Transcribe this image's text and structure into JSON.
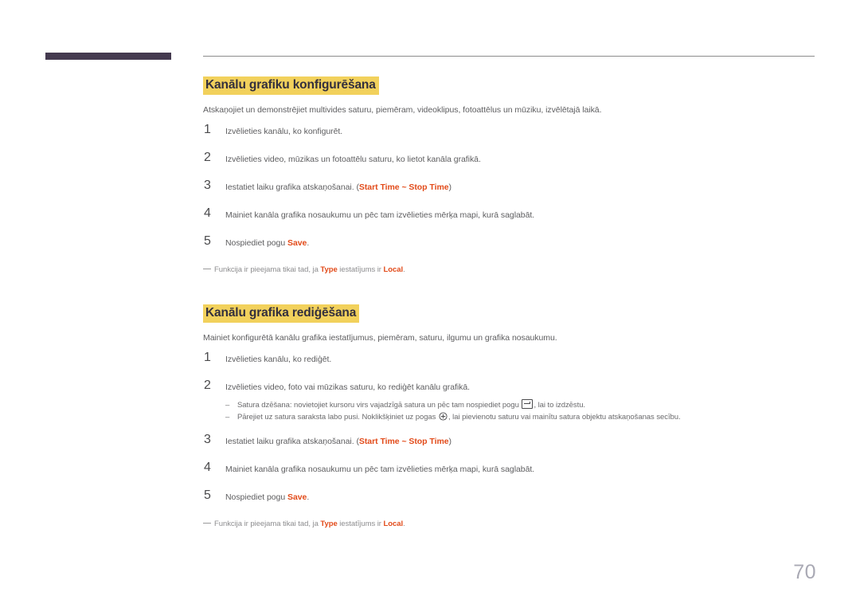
{
  "page": {
    "number": "70",
    "accent_color": "#e24b1a",
    "highlight_color": "#f2d15c",
    "header_bar_color": "#443a4f"
  },
  "sections": [
    {
      "heading": "Kanālu grafiku konfigurēšana",
      "intro": "Atskaņojiet un demonstrējiet multivides saturu, piemēram, videoklipus, fotoattēlus un mūziku, izvēlētajā laikā.",
      "steps": [
        {
          "num": "1",
          "parts": [
            {
              "t": "text",
              "v": "Izvēlieties kanālu, ko konfigurēt."
            }
          ]
        },
        {
          "num": "2",
          "parts": [
            {
              "t": "text",
              "v": "Izvēlieties video, mūzikas un fotoattēlu saturu, ko lietot kanāla grafikā."
            }
          ]
        },
        {
          "num": "3",
          "parts": [
            {
              "t": "text",
              "v": "Iestatiet laiku grafika atskaņošanai. ("
            },
            {
              "t": "kw",
              "v": "Start Time"
            },
            {
              "t": "kw",
              "v": " ~ "
            },
            {
              "t": "kw",
              "v": "Stop Time"
            },
            {
              "t": "text",
              "v": ")"
            }
          ]
        },
        {
          "num": "4",
          "parts": [
            {
              "t": "text",
              "v": "Mainiet kanāla grafika nosaukumu un pēc tam izvēlieties mērķa mapi, kurā saglabāt."
            }
          ]
        },
        {
          "num": "5",
          "parts": [
            {
              "t": "text",
              "v": "Nospiediet pogu "
            },
            {
              "t": "kw",
              "v": "Save"
            },
            {
              "t": "text",
              "v": "."
            }
          ]
        }
      ],
      "note": [
        {
          "t": "text",
          "v": "Funkcija ir pieejama tikai tad, ja "
        },
        {
          "t": "kw",
          "v": "Type"
        },
        {
          "t": "text",
          "v": " iestatījums ir "
        },
        {
          "t": "kw",
          "v": "Local"
        },
        {
          "t": "text",
          "v": "."
        }
      ]
    },
    {
      "heading": "Kanālu grafika rediģēšana",
      "intro": "Mainiet konfigurētā kanālu grafika iestatījumus, piemēram, saturu, ilgumu un grafika nosaukumu.",
      "steps": [
        {
          "num": "1",
          "parts": [
            {
              "t": "text",
              "v": "Izvēlieties kanālu, ko rediģēt."
            }
          ]
        },
        {
          "num": "2",
          "parts": [
            {
              "t": "text",
              "v": "Izvēlieties video, foto vai mūzikas saturu, ko rediģēt kanālu grafikā."
            }
          ],
          "subs": [
            [
              {
                "t": "text",
                "v": "Satura dzēšana: novietojiet kursoru virs vajadzīgā satura un pēc tam nospiediet pogu "
              },
              {
                "t": "icon",
                "v": "delete-key-icon"
              },
              {
                "t": "text",
                "v": ", lai to izdzēstu."
              }
            ],
            [
              {
                "t": "text",
                "v": "Pārejiet uz satura saraksta labo pusi. Noklikšķiniet uz pogas "
              },
              {
                "t": "icon",
                "v": "plus-circle-icon"
              },
              {
                "t": "text",
                "v": ", lai pievienotu saturu vai mainītu satura objektu atskaņošanas secību."
              }
            ]
          ]
        },
        {
          "num": "3",
          "parts": [
            {
              "t": "text",
              "v": "Iestatiet laiku grafika atskaņošanai. ("
            },
            {
              "t": "kw",
              "v": "Start Time"
            },
            {
              "t": "kw",
              "v": " ~ "
            },
            {
              "t": "kw",
              "v": "Stop Time"
            },
            {
              "t": "text",
              "v": ")"
            }
          ]
        },
        {
          "num": "4",
          "parts": [
            {
              "t": "text",
              "v": "Mainiet kanāla grafika nosaukumu un pēc tam izvēlieties mērķa mapi, kurā saglabāt."
            }
          ]
        },
        {
          "num": "5",
          "parts": [
            {
              "t": "text",
              "v": "Nospiediet pogu "
            },
            {
              "t": "kw",
              "v": "Save"
            },
            {
              "t": "text",
              "v": "."
            }
          ]
        }
      ],
      "note": [
        {
          "t": "text",
          "v": "Funkcija ir pieejama tikai tad, ja "
        },
        {
          "t": "kw",
          "v": "Type"
        },
        {
          "t": "text",
          "v": " iestatījums ir "
        },
        {
          "t": "kw",
          "v": "Local"
        },
        {
          "t": "text",
          "v": "."
        }
      ]
    }
  ]
}
